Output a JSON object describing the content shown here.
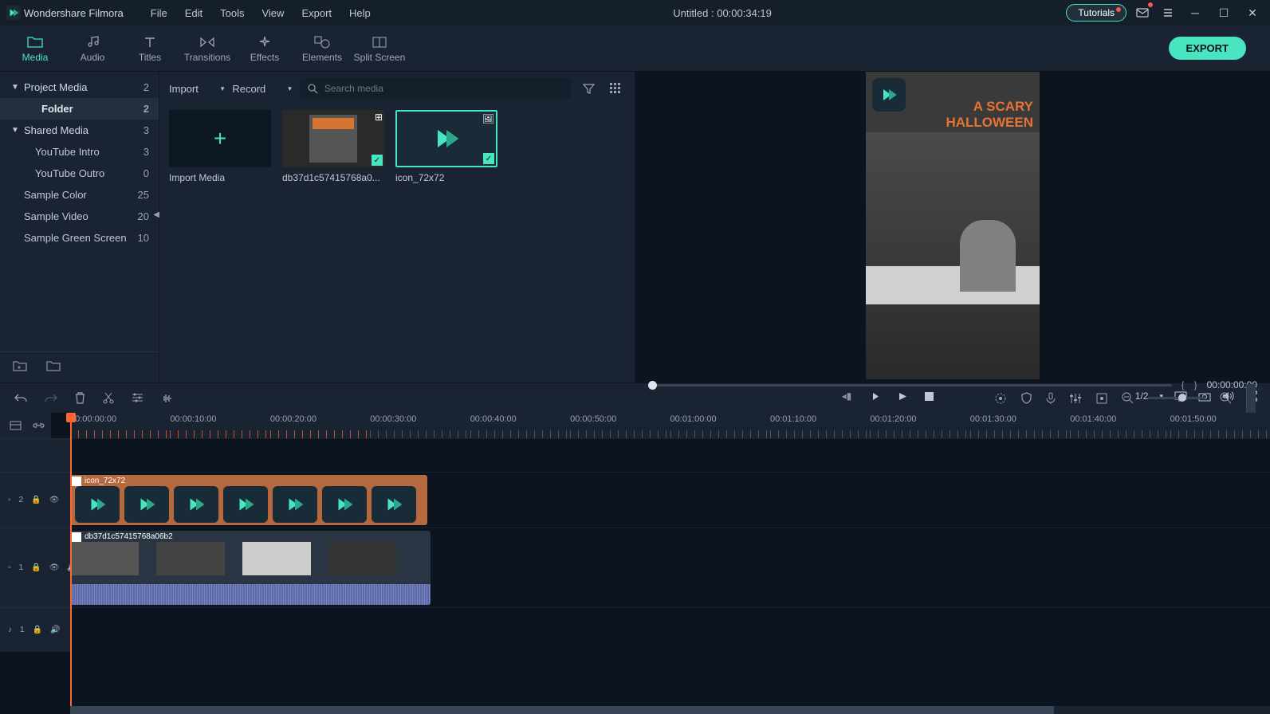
{
  "app": {
    "title": "Wondershare Filmora"
  },
  "menu": [
    "File",
    "Edit",
    "Tools",
    "View",
    "Export",
    "Help"
  ],
  "document": {
    "title": "Untitled : 00:00:34:19"
  },
  "titlebar": {
    "tutorials": "Tutorials"
  },
  "tabs": [
    {
      "label": "Media",
      "icon": "folder"
    },
    {
      "label": "Audio",
      "icon": "music"
    },
    {
      "label": "Titles",
      "icon": "text"
    },
    {
      "label": "Transitions",
      "icon": "transition"
    },
    {
      "label": "Effects",
      "icon": "sparkle"
    },
    {
      "label": "Elements",
      "icon": "shapes"
    },
    {
      "label": "Split Screen",
      "icon": "split"
    }
  ],
  "export_label": "EXPORT",
  "sidebar": {
    "items": [
      {
        "label": "Project Media",
        "count": "2",
        "chevron": true
      },
      {
        "label": "Folder",
        "count": "2",
        "bold": true
      },
      {
        "label": "Shared Media",
        "count": "3",
        "chevron": true
      },
      {
        "label": "YouTube Intro",
        "count": "3",
        "indent": true
      },
      {
        "label": "YouTube Outro",
        "count": "0",
        "indent": true
      },
      {
        "label": "Sample Color",
        "count": "25"
      },
      {
        "label": "Sample Video",
        "count": "20"
      },
      {
        "label": "Sample Green Screen",
        "count": "10"
      }
    ]
  },
  "media": {
    "import": "Import",
    "record": "Record",
    "search_placeholder": "Search media",
    "cards": [
      {
        "label": "Import Media",
        "type": "add"
      },
      {
        "label": "db37d1c57415768a0...",
        "type": "video"
      },
      {
        "label": "icon_72x72",
        "type": "image",
        "selected": true
      }
    ]
  },
  "preview": {
    "overlay_line1": "A SCARY",
    "overlay_line2": "HALLOWEEN",
    "time": "00:00:00:00",
    "ratio": "1/2"
  },
  "ruler": [
    "00:00:00:00",
    "00:00:10:00",
    "00:00:20:00",
    "00:00:30:00",
    "00:00:40:00",
    "00:00:50:00",
    "00:01:00:00",
    "00:01:10:00",
    "00:01:20:00",
    "00:01:30:00",
    "00:01:40:00",
    "00:01:50:00"
  ],
  "tracks": {
    "t2": {
      "name": "2",
      "clip": "icon_72x72"
    },
    "t1": {
      "name": "1",
      "clip": "db37d1c57415768a06b2"
    },
    "a1": {
      "name": "1"
    }
  }
}
